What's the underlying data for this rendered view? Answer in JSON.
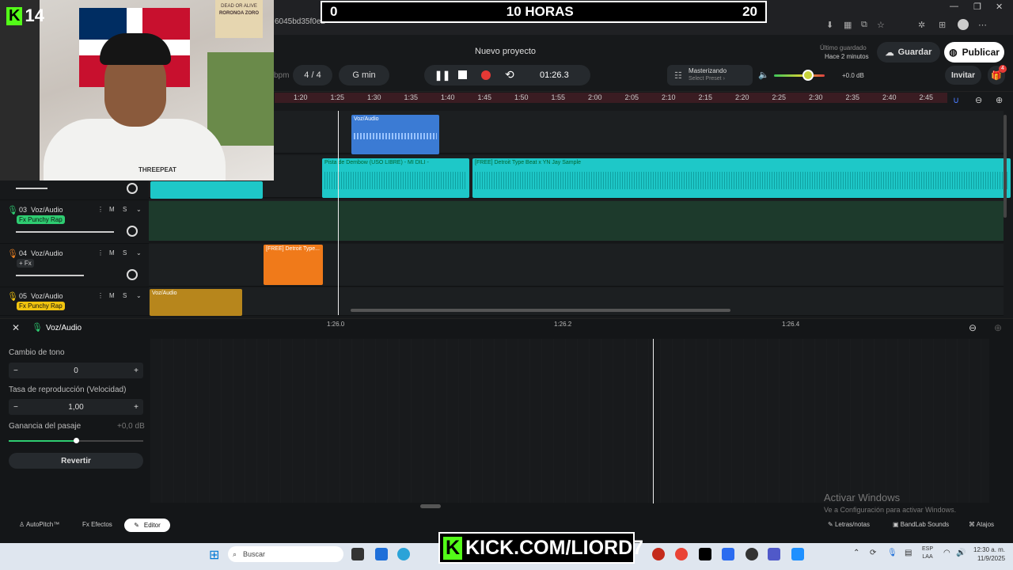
{
  "browser": {
    "url_fragment": "6045bd35f0e2"
  },
  "overlay": {
    "counter_left": "0",
    "counter_title": "10 HORAS",
    "counter_right": "20",
    "badge": "14",
    "kick_url": "KICK.COM/LIORD7",
    "webcam_shirt": "THREEPEAT",
    "poster_top": "DEAD OR ALIVE",
    "poster_name": "RORONOA ZORO"
  },
  "header": {
    "project_title": "Nuevo proyecto",
    "bpm_unit": "bpm",
    "time_sig": "4 / 4",
    "key": "G min",
    "time": "01:26.3",
    "master_label": "Masterizando",
    "master_sub": "Select Preset ›",
    "volume_db": "+0.0 dB",
    "saved_label": "Último guardado",
    "saved_time": "Hace 2 minutos",
    "save_btn": "Guardar",
    "publish_btn": "Publicar",
    "invite_btn": "Invitar",
    "gift_badge": "4"
  },
  "ruler": [
    "1:20",
    "1:25",
    "1:30",
    "1:35",
    "1:40",
    "1:45",
    "1:50",
    "1:55",
    "2:00",
    "2:05",
    "2:10",
    "2:15",
    "2:20",
    "2:25",
    "2:30",
    "2:35",
    "2:40",
    "2:45"
  ],
  "tracks": [
    {
      "num": "03",
      "name": "Voz/Audio",
      "fx": "Fx Punchy Rap",
      "color": "#2ecc71"
    },
    {
      "num": "04",
      "name": "Voz/Audio",
      "fx": "+ Fx",
      "color": "#e67e22"
    },
    {
      "num": "05",
      "name": "Voz/Audio",
      "fx": "Fx Punchy Rap",
      "color": "#f1c40f"
    }
  ],
  "track_btns": {
    "mute": "M",
    "solo": "S"
  },
  "clips": {
    "vox1": "Voz/Audio",
    "beat1": "Pista de Dembow (USO LIBRE) - MI DILI -",
    "beat2": "[FREE] Detroit Type Beat x YN Jay Sample",
    "orange": "[FREE] Detroit Type...",
    "yellow": "Voz/Audio"
  },
  "editor": {
    "title": "Voz/Audio",
    "t1": "1:26.0",
    "t2": "1:26.2",
    "t3": "1:26.4",
    "pitch_label": "Cambio de tono",
    "pitch_value": "0",
    "rate_label": "Tasa de reproducción (Velocidad)",
    "rate_value": "1,00",
    "gain_label": "Ganancia del pasaje",
    "gain_value": "+0,0 dB",
    "revert_btn": "Revertir",
    "playback_rate": 1.0,
    "gain_slider_fraction": 0.5
  },
  "bottom": {
    "autopitch": "AutoPitch™",
    "effects": "Efectos",
    "editor": "Editor",
    "lyrics": "Letras/notas",
    "sounds": "BandLab Sounds",
    "shortcuts": "Atajos"
  },
  "windows": {
    "activate_title": "Activar Windows",
    "activate_sub": "Ve a Configuración para activar Windows.",
    "search": "Buscar",
    "lang1": "ESP",
    "lang2": "LAA",
    "clock": "12:30 a. m.",
    "date": "11/9/2025"
  },
  "colors": {
    "teal": "#1ec8c8",
    "blue": "#3b7bd4",
    "orange": "#f07a1a",
    "yellow": "#d9a020",
    "record": "#e53935",
    "kick": "#53fc18"
  }
}
